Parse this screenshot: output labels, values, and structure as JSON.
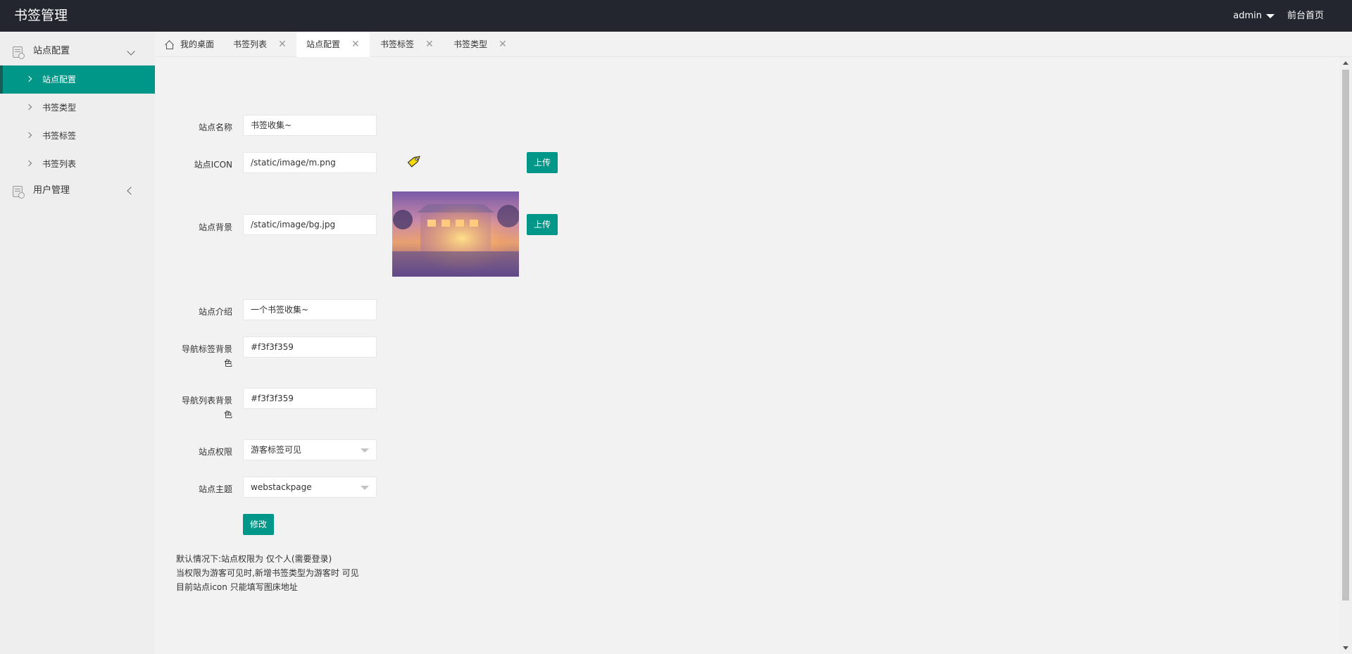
{
  "header": {
    "app_title": "书签管理",
    "user_name": "admin",
    "front_link": "前台首页"
  },
  "sidebar": {
    "groups": [
      {
        "label": "站点配置",
        "items": [
          {
            "label": "站点配置"
          },
          {
            "label": "书签类型"
          },
          {
            "label": "书签标签"
          },
          {
            "label": "书签列表"
          }
        ]
      },
      {
        "label": "用户管理"
      }
    ]
  },
  "tabs": [
    {
      "label": "我的桌面"
    },
    {
      "label": "书签列表"
    },
    {
      "label": "站点配置"
    },
    {
      "label": "书签标签"
    },
    {
      "label": "书签类型"
    }
  ],
  "form": {
    "site_name": {
      "label": "站点名称",
      "value": "书签收集~"
    },
    "site_icon": {
      "label": "站点ICON",
      "value": "/static/image/m.png",
      "upload_label": "上传"
    },
    "site_bg": {
      "label": "站点背景",
      "value": "/static/image/bg.jpg",
      "upload_label": "上传"
    },
    "site_intro": {
      "label": "站点介绍",
      "value": "一个书签收集~"
    },
    "nav_tag_bg": {
      "label_line1": "导航标签背景",
      "label_line2": "色",
      "value": "#f3f3f359"
    },
    "nav_list_bg": {
      "label_line1": "导航列表背景",
      "label_line2": "色",
      "value": "#f3f3f359"
    },
    "site_permission": {
      "label": "站点权限",
      "value": "游客标签可见"
    },
    "site_theme": {
      "label": "站点主题",
      "value": "webstackpage"
    },
    "submit_label": "修改"
  },
  "notes": [
    "默认情况下:站点权限为 仅个人(需要登录)",
    "当权限为游客可见时,新增书签类型为游客时 可见",
    "目前站点icon 只能填写图床地址"
  ],
  "colors": {
    "header_bg": "#23262e",
    "accent": "#009688",
    "sidebar_bg": "#eeeeee",
    "content_bg": "#f2f2f2"
  }
}
